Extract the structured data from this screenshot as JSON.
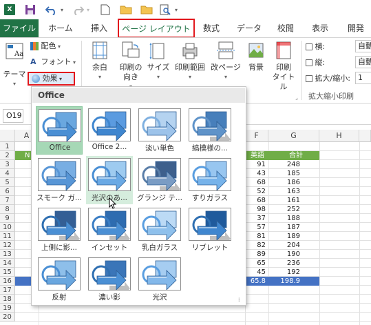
{
  "qat": {
    "app_icon": "X",
    "save_icon": "save-icon",
    "undo_icon": "undo-icon",
    "redo_icon": "redo-icon",
    "new_icon": "new-file-icon",
    "open_icon": "open-folder-icon",
    "folder2_icon": "folder-icon",
    "preview_icon": "print-preview-icon"
  },
  "tabs": [
    {
      "label": "ファイル"
    },
    {
      "label": "ホーム"
    },
    {
      "label": "挿入"
    },
    {
      "label": "ページ レイアウト"
    },
    {
      "label": "数式"
    },
    {
      "label": "データ"
    },
    {
      "label": "校閲"
    },
    {
      "label": "表示"
    },
    {
      "label": "開発"
    }
  ],
  "ribbon": {
    "theme_label": "テーマ",
    "colors_label": "配色",
    "font_label": "フォント",
    "effects_label": "効果",
    "margins_label": "余白",
    "orientation_label1": "印刷の",
    "orientation_label2": "向き",
    "size_label": "サイズ",
    "printarea_label": "印刷範囲",
    "breaks_label": "改ページ",
    "background_label": "背景",
    "printtitles_label1": "印刷",
    "printtitles_label2": "タイトル",
    "width_label": "横:",
    "width_value": "自動",
    "height_label": "縦:",
    "height_value": "自動",
    "scale_label": "拡大/縮小:",
    "scale_value": "1",
    "group_label": "拡大縮小印刷"
  },
  "namebox": "O19",
  "columns": [
    "A",
    "F",
    "G",
    "H"
  ],
  "rows": [
    "1",
    "2",
    "3",
    "4",
    "5",
    "6",
    "7",
    "8",
    "9",
    "10",
    "11",
    "12",
    "13",
    "14",
    "15",
    "16",
    "17",
    "18",
    "19",
    "20"
  ],
  "cells": {
    "row2_label": "N",
    "f2": "英語",
    "g2": "合計",
    "f_values": [
      "91",
      "43",
      "68",
      "52",
      "68",
      "98",
      "37",
      "57",
      "81",
      "82",
      "89",
      "65",
      "45"
    ],
    "g_values": [
      "248",
      "185",
      "186",
      "163",
      "161",
      "252",
      "188",
      "187",
      "189",
      "204",
      "190",
      "236",
      "192"
    ],
    "f15": "65.8",
    "g15": "198.9"
  },
  "gallery": {
    "header": "Office",
    "items": [
      {
        "label": "Office"
      },
      {
        "label": "Office 2..."
      },
      {
        "label": "淡い単色"
      },
      {
        "label": "縞模様の..."
      },
      {
        "label": "スモーク ガ..."
      },
      {
        "label": "光沢のあ..."
      },
      {
        "label": "グランジ テ..."
      },
      {
        "label": "すりガラス"
      },
      {
        "label": "上側に影..."
      },
      {
        "label": "インセット"
      },
      {
        "label": "乳白ガラス"
      },
      {
        "label": "リブレット"
      },
      {
        "label": "反射"
      },
      {
        "label": "濃い影"
      },
      {
        "label": "光沢"
      }
    ]
  },
  "colors": {
    "excel_green": "#217346",
    "highlight_red": "#e2171d",
    "row15_blue": "#4472c4",
    "header_green": "#70ad47"
  }
}
